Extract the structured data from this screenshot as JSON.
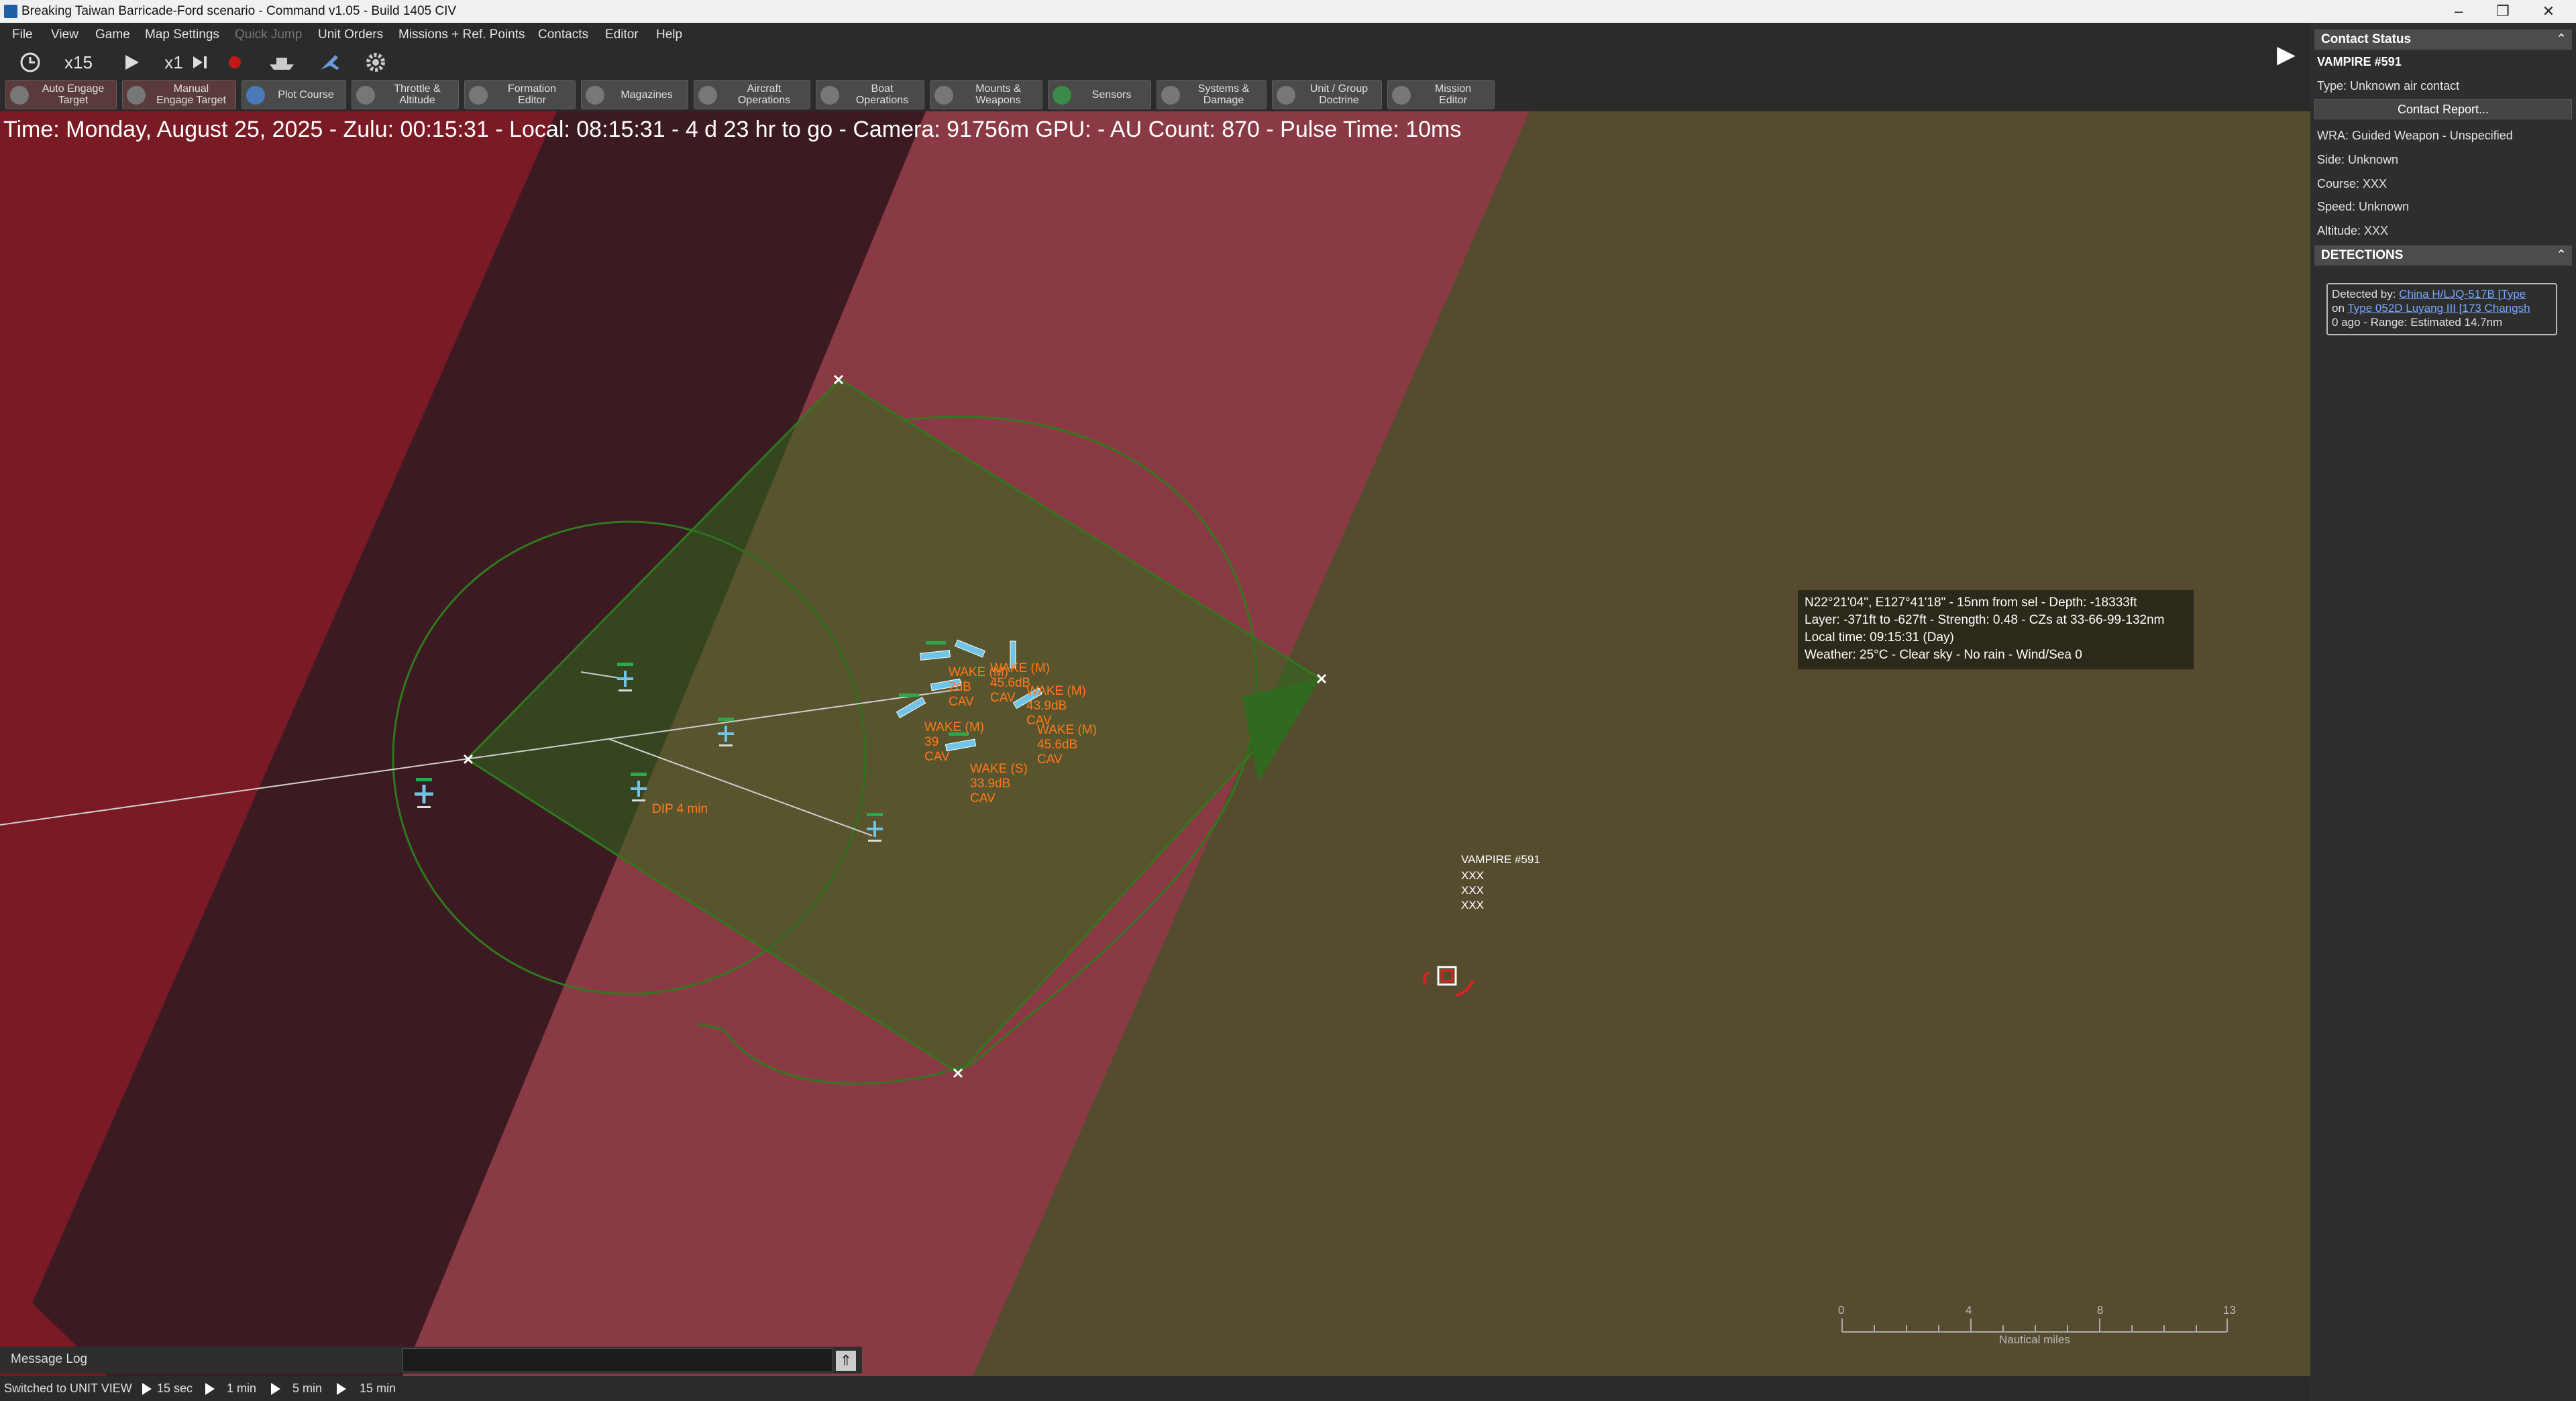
{
  "window": {
    "title": "Breaking Taiwan Barricade-Ford scenario - Command v1.05 - Build 1405 CIV",
    "minimize": "–",
    "maximize": "❐",
    "close": "✕"
  },
  "menu": {
    "file": "File",
    "view": "View",
    "game": "Game",
    "map_settings": "Map Settings",
    "quick_jump": "Quick Jump",
    "unit_orders": "Unit Orders",
    "missions": "Missions + Ref. Points",
    "contacts": "Contacts",
    "editor": "Editor",
    "help": "Help"
  },
  "toolbar1": {
    "compression": "x15",
    "speed": "x1"
  },
  "toolbar2": [
    {
      "label": "Auto Engage\nTarget"
    },
    {
      "label": "Manual\nEngage Target"
    },
    {
      "label": "Plot Course"
    },
    {
      "label": "Throttle &\nAltitude"
    },
    {
      "label": "Formation\nEditor"
    },
    {
      "label": "Magazines"
    },
    {
      "label": "Aircraft\nOperations"
    },
    {
      "label": "Boat\nOperations"
    },
    {
      "label": "Mounts &\nWeapons"
    },
    {
      "label": "Sensors"
    },
    {
      "label": "Systems &\nDamage"
    },
    {
      "label": "Unit / Group\nDoctrine"
    },
    {
      "label": "Mission\nEditor"
    }
  ],
  "map": {
    "status_line": "Time: Monday, August 25, 2025 - Zulu: 00:15:31 - Local: 08:15:31 - 4 d 23 hr to go -  Camera: 91756m  GPU:  - AU Count: 870 - Pulse Time: 10ms",
    "labels": {
      "wake1": "WAKE (M)\n45.6dB\nCAV",
      "wake2": "WAKE (M)\n43.9dB\nCAV",
      "wake3": "WAKE (M)\n45.6dB\nCAV",
      "wake4": "WAKE (S)\n33.9dB\nCAV",
      "wake5": "WAKE (M)\n39\nCAV",
      "wake6": "WAKE (M)\n2dB\nCAV",
      "dip": "DIP 4 min"
    },
    "contact": {
      "name": "VAMPIRE #591",
      "line1": "XXX",
      "line2": "XXX",
      "line3": "XXX"
    },
    "tooltip": {
      "line1": "N22°21'04\", E127°41'18\" - 15nm from sel - Depth: -18333ft",
      "line2": "Layer: -371ft to -627ft - Strength: 0.48 - CZs at 33-66-99-132nm",
      "line3": "Local time: 09:15:31 (Day)",
      "line4": "Weather: 25°C - Clear sky - No rain - Wind/Sea 0"
    },
    "scale": {
      "t0": "0",
      "t1": "4",
      "t2": "8",
      "t3": "13",
      "unit": "Nautical miles"
    }
  },
  "message_log": {
    "label": "Message Log"
  },
  "bottom_bar": {
    "status": "Switched to UNIT VIEW",
    "step1": "15 sec",
    "step2": "1 min",
    "step3": "5 min",
    "step4": "15 min"
  },
  "contact_panel": {
    "header": "Contact Status",
    "name": "VAMPIRE #591",
    "type": "Type: Unknown air contact",
    "report_button": "Contact Report...",
    "wra": "WRA: Guided Weapon - Unspecified",
    "side": "Side: Unknown",
    "course": "Course: XXX",
    "speed": "Speed: Unknown",
    "altitude": "Altitude: XXX",
    "detections_header": "DETECTIONS",
    "detected_by_label": "Detected by: ",
    "detected_by_link": "China H/LJQ-517B [Type",
    "on_label": "on ",
    "on_link": "Type 052D Luyang III [173 Changsh",
    "range": "0 ago   - Range: Estimated 14.7nm"
  },
  "colors": {
    "sea": "#554c30",
    "zone_red": "#7a1a24",
    "zone_pink": "#8a3a44",
    "zone_dark": "#3b1a22",
    "range_green": "#2f6a1e",
    "wake_orange": "#ff7a1a",
    "hostile_red": "#e02020"
  }
}
